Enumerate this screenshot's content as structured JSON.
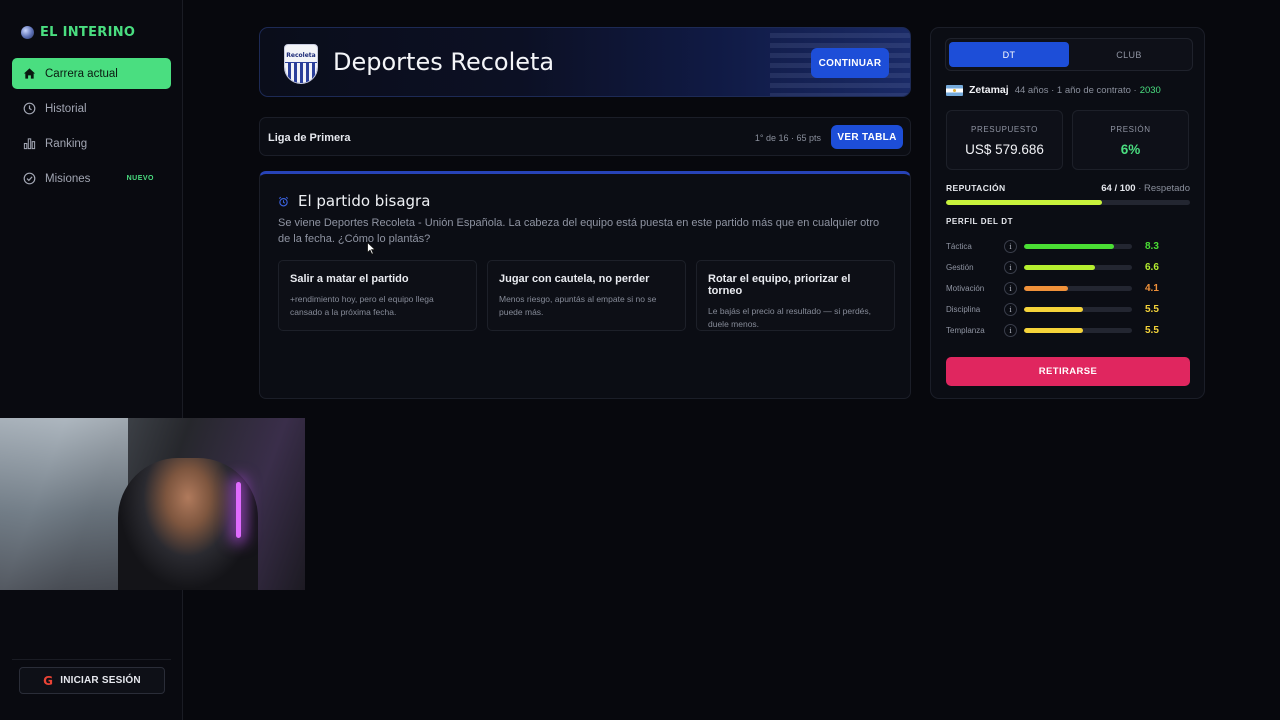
{
  "app": {
    "title": "EL INTERINO"
  },
  "sidebar": {
    "items": [
      {
        "label": "Carrera actual",
        "icon": "home-icon",
        "active": true
      },
      {
        "label": "Historial",
        "icon": "clock-icon"
      },
      {
        "label": "Ranking",
        "icon": "bar-chart-icon"
      },
      {
        "label": "Misiones",
        "icon": "check-circle-icon",
        "badge": "NUEVO"
      }
    ],
    "login_label": "INICIAR SESIÓN",
    "login_icon": "G"
  },
  "team": {
    "crest_label": "Recoleta",
    "name": "Deportes Recoleta",
    "continue_label": "CONTINUAR"
  },
  "league": {
    "name": "Liga de Primera",
    "position": "1° de 16 · 65 pts",
    "table_label": "VER TABLA"
  },
  "match": {
    "icon": "⏰",
    "title": "El partido bisagra",
    "description": "Se viene Deportes Recoleta - Unión Española. La cabeza del equipo está puesta en este partido más que en cualquier otro de la fecha. ¿Cómo lo plantás?",
    "options": [
      {
        "title": "Salir a matar el partido",
        "desc": "+rendimiento hoy, pero el equipo llega cansado a la próxima fecha."
      },
      {
        "title": "Jugar con cautela, no perder",
        "desc": "Menos riesgo, apuntás al empate si no se puede más."
      },
      {
        "title": "Rotar el equipo, priorizar el torneo",
        "desc": "Le bajás el precio al resultado — si perdés, duele menos."
      }
    ]
  },
  "panel": {
    "tabs": [
      "DT",
      "CLUB"
    ],
    "coach": {
      "name": "Zetamaj",
      "meta": "44 años · 1 año de contrato ·",
      "year": "2030"
    },
    "budget": {
      "label": "PRESUPUESTO",
      "value": "US$ 579.686"
    },
    "pressure": {
      "label": "PRESIÓN",
      "value": "6%"
    },
    "reputation": {
      "label": "REPUTACIÓN",
      "score": "64 / 100",
      "status": "· Respetado",
      "fraction": 0.64
    },
    "profile_title": "PERFIL DEL DT",
    "attributes": [
      {
        "name": "Táctica",
        "value": "8.3",
        "color": "#4ade34"
      },
      {
        "name": "Gestión",
        "value": "6.6",
        "color": "#b5ee2f"
      },
      {
        "name": "Motivación",
        "value": "4.1",
        "color": "#f0913a"
      },
      {
        "name": "Disciplina",
        "value": "5.5",
        "color": "#f5d43a"
      },
      {
        "name": "Templanza",
        "value": "5.5",
        "color": "#f5d43a"
      }
    ],
    "info_glyph": "i",
    "retire_label": "RETIRARSE"
  }
}
